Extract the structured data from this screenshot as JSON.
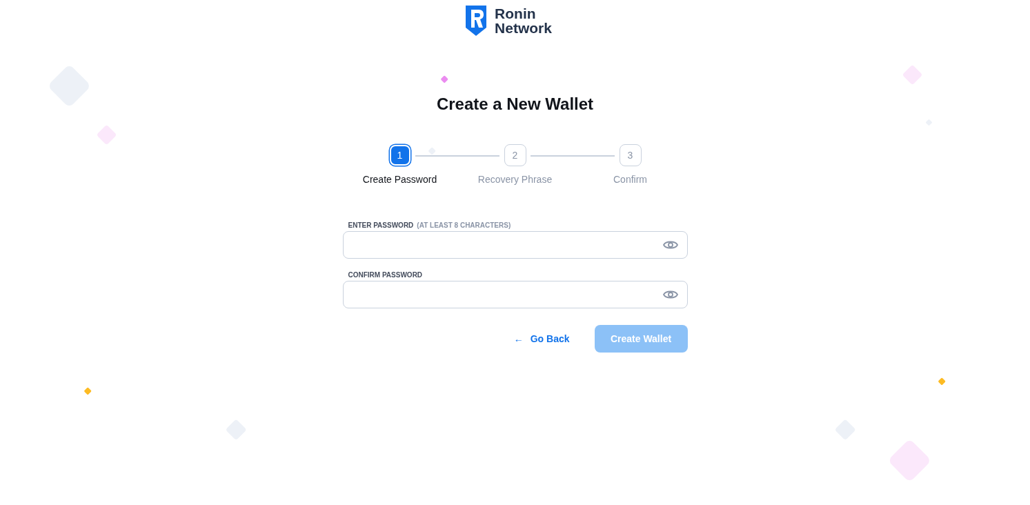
{
  "logo": {
    "line_1": "Ronin",
    "line_2": "Network"
  },
  "title": "Create a New Wallet",
  "steps": [
    {
      "number": "1",
      "label": "Create Password",
      "selected": true
    },
    {
      "number": "2",
      "label": "Recovery Phrase",
      "selected": false
    },
    {
      "number": "3",
      "label": "Confirm",
      "selected": false
    }
  ],
  "fields": [
    {
      "label": "ENTER PASSWORD",
      "hint": "(AT LEAST 8 CHARACTERS)"
    },
    {
      "label": "CONFIRM PASSWORD"
    }
  ],
  "back_button": {
    "arrow": "←",
    "label": "Go Back"
  },
  "create_button": {
    "label": "Create Wallet",
    "disabled": true
  }
}
